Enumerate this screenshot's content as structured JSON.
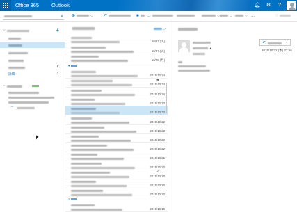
{
  "suite_bar": {
    "product": "Office 365",
    "app": "Outlook",
    "icons": [
      "waffle-icon",
      "bell-icon",
      "gear-icon",
      "help-icon",
      "avatar"
    ]
  },
  "search": {
    "placeholder": ""
  },
  "commands": [
    {
      "icon": "new-icon",
      "glyph": "⊕"
    },
    {
      "icon": "reply-all-icon",
      "glyph": "↶"
    },
    {
      "icon": "delete-icon",
      "glyph": "■"
    },
    {
      "icon": "archive-icon",
      "glyph": "▭"
    },
    {
      "icon": "undo-icon",
      "glyph": "↺"
    }
  ],
  "folders": {
    "unread_count": "1",
    "more_label": "詳細"
  },
  "messages": {
    "dates": [
      "10/27 (火)",
      "10/27 (火)",
      "10/26 (月)",
      "2015/10/24",
      "2015/10/24",
      "2015/10/24",
      "2015/10/23",
      "2015/10/23",
      "2015/10/22",
      "2015/10/22",
      "2015/10/22",
      "2015/10/22",
      "2015/10/21",
      "2015/10/20",
      "2015/10/20",
      "2015/10/20",
      "2015/10/20",
      "2015/10/19",
      "2015/10/16",
      "2015/10/16",
      "2015/10/16",
      "2015/10/15"
    ]
  },
  "reading": {
    "date": "2015/10/22 (木) 22:56"
  },
  "colors": {
    "brand": "#0072c6",
    "selection": "#cde6f7"
  }
}
